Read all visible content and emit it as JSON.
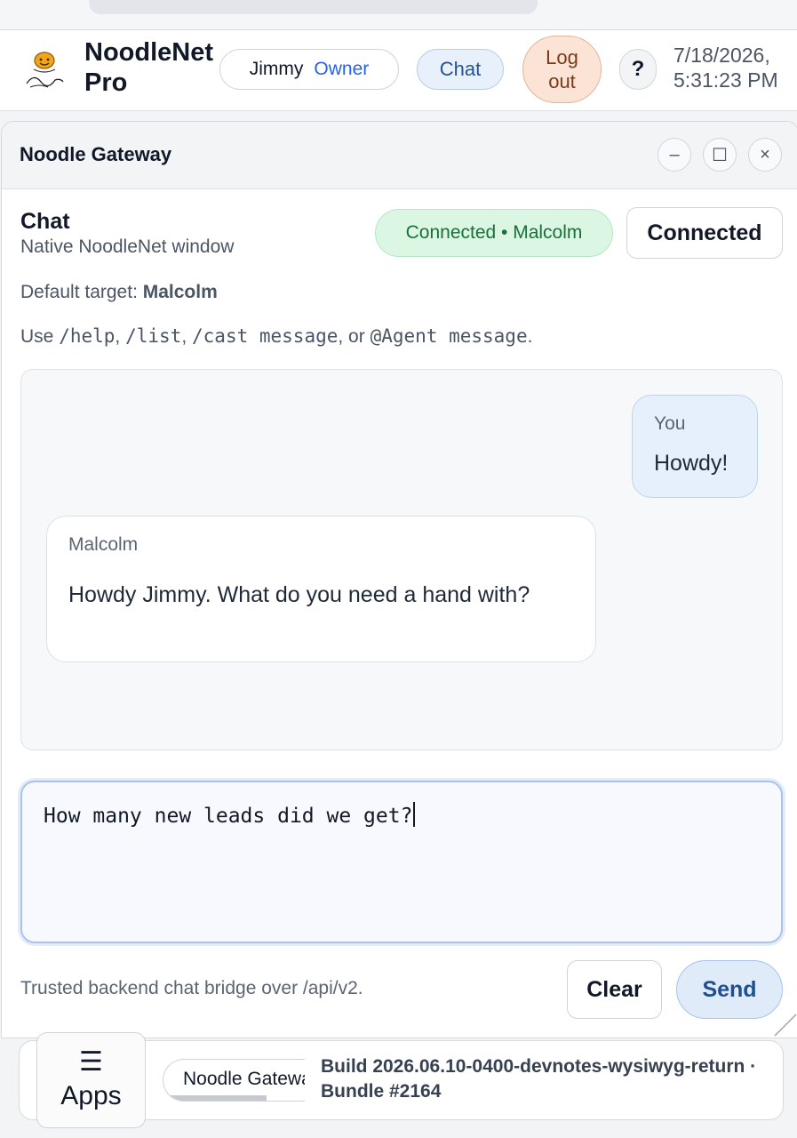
{
  "header": {
    "brand": "NoodleNet Pro",
    "user_name": "Jimmy",
    "user_role": "Owner",
    "chat_label": "Chat",
    "logout_label": "Log out",
    "help_label": "?",
    "datetime_line1": "7/18/2026,",
    "datetime_line2": "5:31:23 PM"
  },
  "window": {
    "title": "Noodle Gateway",
    "minimize_label": "–",
    "maximize_label": "☐",
    "close_label": "×"
  },
  "chat": {
    "title": "Chat",
    "subtitle": "Native NoodleNet window",
    "status_badge": "Connected • Malcolm",
    "connected_button": "Connected",
    "default_target_label": "Default target:",
    "default_target_value": "Malcolm",
    "usage": {
      "prefix": "Use",
      "cmd_help": "/help",
      "sep1": ",",
      "cmd_list": "/list",
      "sep2": ",",
      "cmd_cast": "/cast message",
      "sep3": ", or",
      "cmd_agent": "@Agent message",
      "suffix": "."
    },
    "messages": [
      {
        "sender": "You",
        "text": "Howdy!"
      },
      {
        "sender": "Malcolm",
        "text": "Howdy Jimmy. What do you need a hand with?"
      }
    ],
    "compose_value": "How many new leads did we get?",
    "footer_note": "Trusted backend chat bridge over /api/v2.",
    "clear_label": "Clear",
    "send_label": "Send"
  },
  "taskbar": {
    "apps_icon": "☰",
    "apps_label": "Apps",
    "task_item_label": "Noodle Gateway",
    "build_info": "Build 2026.06.10-0400-devnotes-wysiwyg-return · Bundle #2164"
  },
  "colors": {
    "accent_blue": "#2563eb",
    "status_green_bg": "#dcf6e4",
    "status_green_text": "#17713a",
    "logout_bg": "#fbe3d5",
    "send_bg": "#e0ebfa"
  }
}
